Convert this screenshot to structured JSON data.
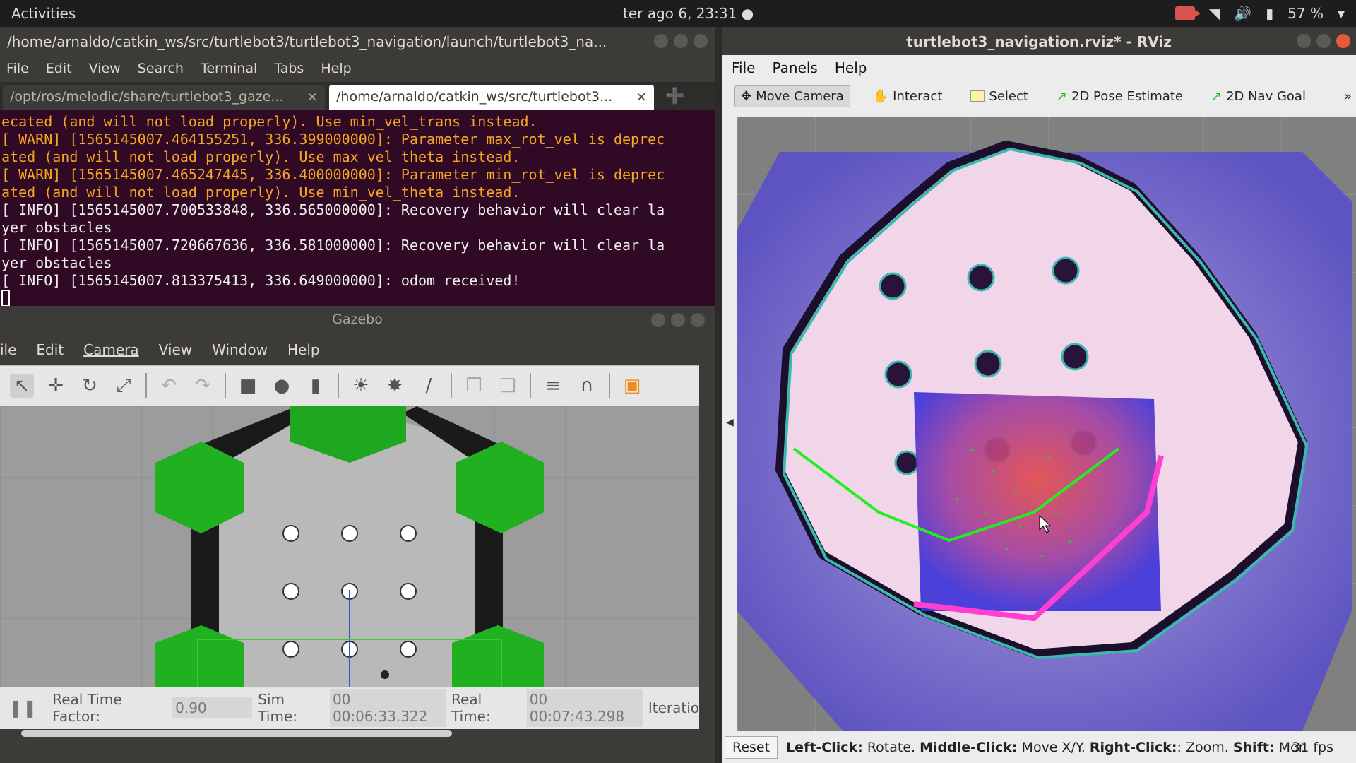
{
  "topbar": {
    "activities": "Activities",
    "clock": "ter ago  6, 23:31 ●",
    "battery": "57 %"
  },
  "terminal": {
    "title": "/home/arnaldo/catkin_ws/src/turtlebot3/turtlebot3_navigation/launch/turtlebot3_na...",
    "menu": [
      "File",
      "Edit",
      "View",
      "Search",
      "Terminal",
      "Tabs",
      "Help"
    ],
    "tabs": [
      {
        "label": "/opt/ros/melodic/share/turtlebot3_gaze...",
        "close": "×"
      },
      {
        "label": "/home/arnaldo/catkin_ws/src/turtlebot3...",
        "close": "×"
      }
    ],
    "lines": [
      {
        "kind": "warn",
        "text": "ecated (and will not load properly). Use min_vel_trans instead."
      },
      {
        "kind": "warn",
        "text": "[ WARN] [1565145007.464155251, 336.399000000]: Parameter max_rot_vel is deprec"
      },
      {
        "kind": "warn",
        "text": "ated (and will not load properly). Use max_vel_theta instead."
      },
      {
        "kind": "warn",
        "text": "[ WARN] [1565145007.465247445, 336.400000000]: Parameter min_rot_vel is deprec"
      },
      {
        "kind": "warn",
        "text": "ated (and will not load properly). Use min_vel_theta instead."
      },
      {
        "kind": "info",
        "text": "[ INFO] [1565145007.700533848, 336.565000000]: Recovery behavior will clear la"
      },
      {
        "kind": "info",
        "text": "yer obstacles"
      },
      {
        "kind": "info",
        "text": "[ INFO] [1565145007.720667636, 336.581000000]: Recovery behavior will clear la"
      },
      {
        "kind": "info",
        "text": "yer obstacles"
      },
      {
        "kind": "info",
        "text": "[ INFO] [1565145007.813375413, 336.649000000]: odom received!"
      }
    ]
  },
  "gazebo": {
    "title": "Gazebo",
    "menu": [
      "ile",
      "Edit",
      "Camera",
      "View",
      "Window",
      "Help"
    ],
    "status": {
      "rtf_label": "Real Time Factor:",
      "rtf_value": "0.90",
      "sim_label": "Sim Time:",
      "sim_value": "00 00:06:33.322",
      "real_label": "Real Time:",
      "real_value": "00 00:07:43.298",
      "iter_label": "Iteratio"
    }
  },
  "rviz": {
    "title": "turtlebot3_navigation.rviz* - RViz",
    "menu": [
      "File",
      "Panels",
      "Help"
    ],
    "tools": [
      {
        "label": "Move Camera",
        "icon": "camera-move-icon"
      },
      {
        "label": "Interact",
        "icon": "hand-icon"
      },
      {
        "label": "Select",
        "icon": "select-box-icon"
      },
      {
        "label": "2D Pose Estimate",
        "icon": "green-arrow-icon"
      },
      {
        "label": "2D Nav Goal",
        "icon": "green-arrow-icon"
      }
    ],
    "status": {
      "reset": "Reset",
      "left_b": "Left-Click:",
      "left_t": "Rotate.",
      "mid_b": "Middle-Click:",
      "mid_t": "Move X/Y.",
      "right_b": "Right-Click:",
      "right_t": ": Zoom.",
      "shift_b": "Shift:",
      "shift_t": "Mor",
      "fps": "31 fps"
    }
  }
}
